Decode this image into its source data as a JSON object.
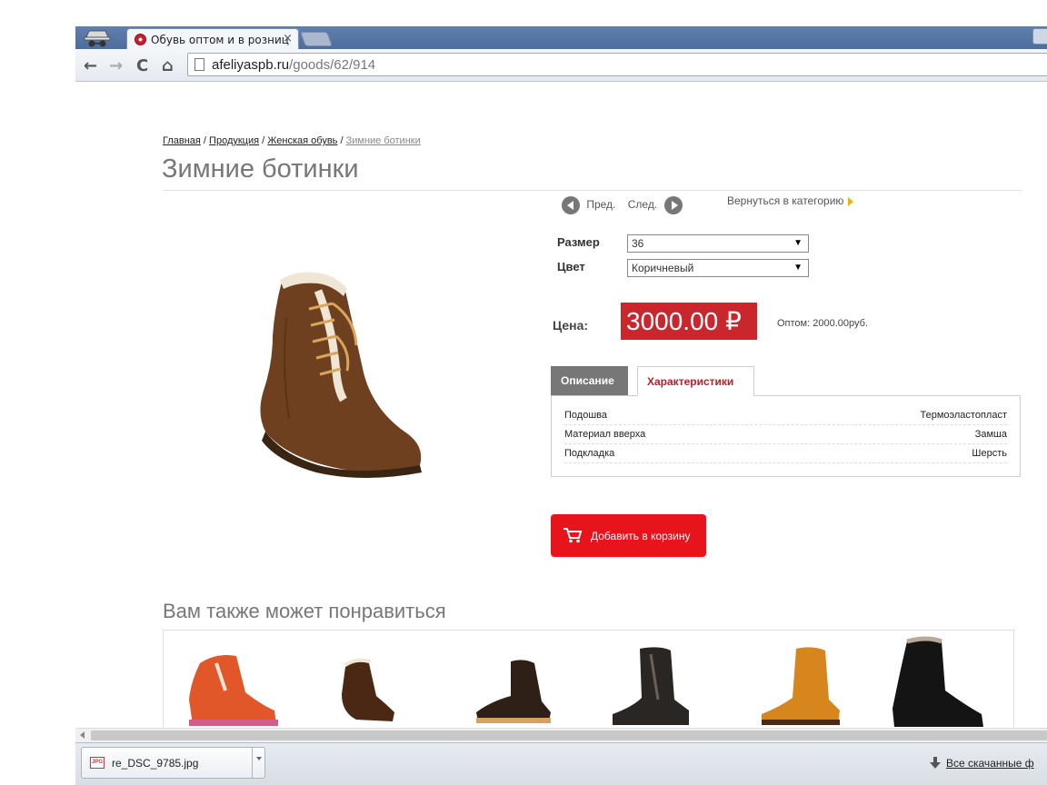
{
  "browser": {
    "tab_title": "Обувь оптом и в розниц",
    "tab_close": "×",
    "url_host": "afeliyaspb.ru",
    "url_path": "/goods/62/914",
    "nav": {
      "back": "←",
      "forward": "→",
      "reload": "C",
      "home": "⌂"
    }
  },
  "breadcrumb": {
    "items": [
      "Главная",
      "Продукция",
      "Женская обувь"
    ],
    "separator": " / ",
    "current": "Зимние ботинки"
  },
  "product": {
    "title": "Зимние ботинки",
    "prev_label": "Пред.",
    "next_label": "След.",
    "back_to_category": "Вернуться в категорию",
    "size_label": "Размер",
    "size_value": "36",
    "color_label": "Цвет",
    "color_value": "Коричневый",
    "price_label": "Цена:",
    "price": "3000.00 ₽",
    "wholesale": "Оптом: 2000.00руб.",
    "tabs": {
      "description": "Описание",
      "specs": "Характеристики"
    },
    "specs": [
      {
        "name": "Подошва",
        "value": "Термоэластопласт"
      },
      {
        "name": "Материал вверха",
        "value": "Замша"
      },
      {
        "name": "Подкладка",
        "value": "Шерсть"
      }
    ],
    "cart_button": "Добавить в корзину"
  },
  "related": {
    "title": "Вам также может понравиться"
  },
  "downloads": {
    "file_name": "re_DSC_9785.jpg",
    "file_type": "JPG",
    "all_downloads": "Все скачанные ф"
  },
  "colors": {
    "price_bg": "#c9262e",
    "cart_bg": "#e8141c",
    "tab_active_text": "#b4222a",
    "chrome_blue": "#5f7fae"
  }
}
